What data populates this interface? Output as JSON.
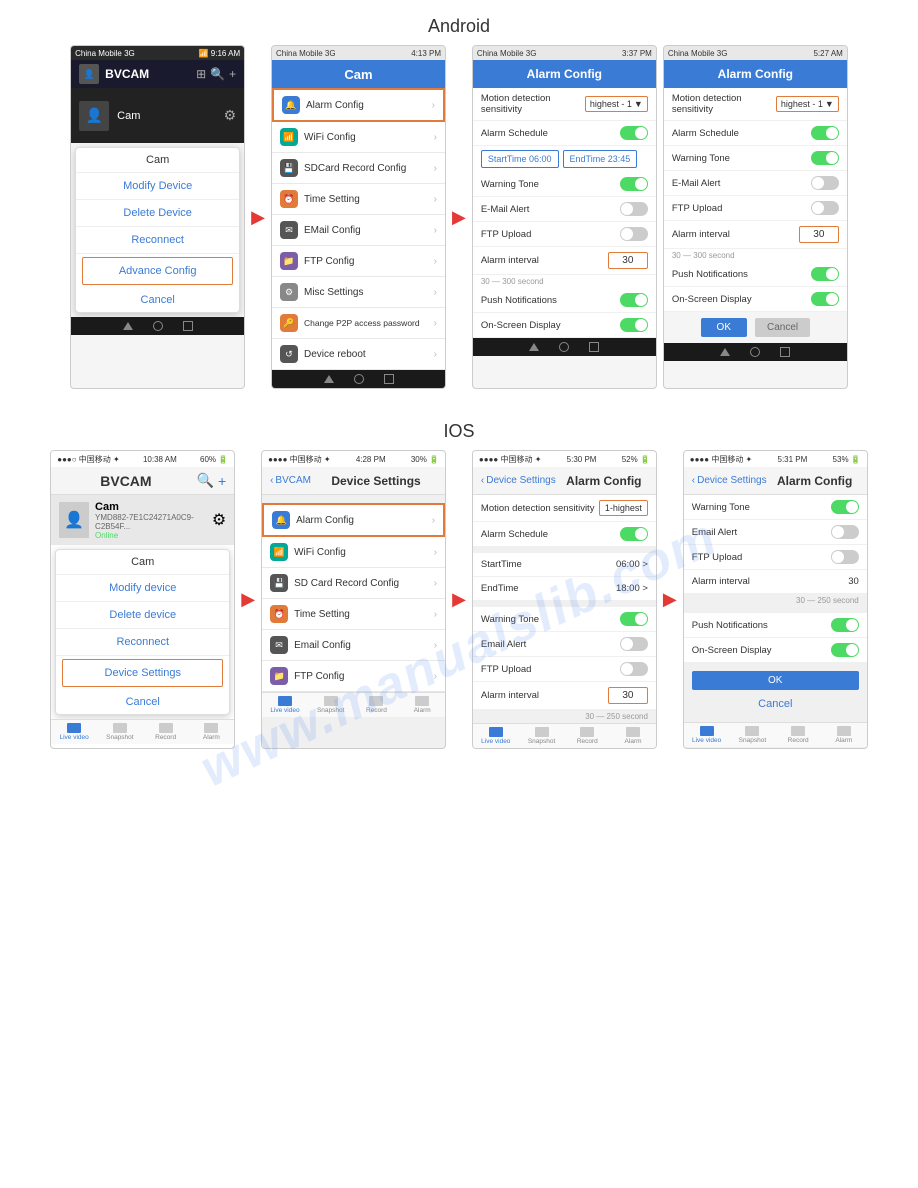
{
  "watermark": {
    "line1": "www.manualslib.com",
    "line2": "www.manualslib.com"
  },
  "android": {
    "label": "Android",
    "phones": [
      {
        "id": "android-1",
        "status_bar": {
          "carrier": "China Mobile 3G",
          "time": "9:16 AM",
          "icons": "signal wifi bat"
        },
        "header": {
          "title": "BVCAM",
          "type": "dark"
        },
        "cam_name": "Cam",
        "menu_items": [
          {
            "label": "Modify Device",
            "type": "normal"
          },
          {
            "label": "Delete Device",
            "type": "normal"
          },
          {
            "label": "Reconnect",
            "type": "normal"
          },
          {
            "label": "Advance Config",
            "type": "highlighted"
          }
        ],
        "cancel": "Cancel",
        "bottom_nav": [
          "back",
          "home",
          "recent"
        ]
      },
      {
        "id": "android-2",
        "status_bar": {
          "carrier": "China Mobile 3G",
          "time": "4:13 PM",
          "icons": "signal wifi bat"
        },
        "header": {
          "title": "Cam",
          "type": "light"
        },
        "list_items": [
          {
            "label": "Alarm Config",
            "icon": "bell",
            "icon_color": "blue",
            "highlighted": true
          },
          {
            "label": "WiFi Config",
            "icon": "wifi",
            "icon_color": "teal"
          },
          {
            "label": "SDCard Record Config",
            "icon": "sd",
            "icon_color": "dark-gray"
          },
          {
            "label": "Time Setting",
            "icon": "clock",
            "icon_color": "orange"
          },
          {
            "label": "EMail Config",
            "icon": "mail",
            "icon_color": "dark-gray"
          },
          {
            "label": "FTP Config",
            "icon": "ftp",
            "icon_color": "purple"
          },
          {
            "label": "Misc Settings",
            "icon": "gear",
            "icon_color": "gear"
          },
          {
            "label": "Change P2P access password",
            "icon": "key",
            "icon_color": "key"
          },
          {
            "label": "Device reboot",
            "icon": "refresh",
            "icon_color": "refresh"
          }
        ],
        "bottom_nav": [
          "back",
          "home",
          "recent"
        ]
      },
      {
        "id": "android-3",
        "status_bar": {
          "carrier": "China Mobile 3G",
          "time": "3:37 PM",
          "icons": "signal wifi bat"
        },
        "header": {
          "title": "Alarm Config",
          "type": "light"
        },
        "rows": [
          {
            "label": "Motion detection sensitivity",
            "value": "highest - 1",
            "type": "dropdown"
          },
          {
            "label": "Alarm Schedule",
            "value": "on",
            "type": "toggle"
          },
          {
            "type": "time_btns",
            "start": "StartTime 06:00",
            "end": "EndTime 23:45"
          },
          {
            "label": "Warning Tone",
            "value": "on",
            "type": "toggle"
          },
          {
            "label": "E-Mail Alert",
            "value": "off",
            "type": "toggle"
          },
          {
            "label": "FTP Upload",
            "value": "off",
            "type": "toggle"
          },
          {
            "label": "Alarm interval",
            "value": "30",
            "type": "input"
          },
          {
            "type": "hint",
            "text": "30 — 300 second"
          },
          {
            "label": "Push Notifications",
            "value": "on",
            "type": "toggle"
          },
          {
            "label": "On-Screen Display",
            "value": "on",
            "type": "toggle"
          }
        ],
        "bottom_nav": [
          "back",
          "home",
          "recent"
        ]
      },
      {
        "id": "android-4",
        "status_bar": {
          "carrier": "China Mobile 3G",
          "time": "5:27 AM",
          "icons": "signal wifi bat"
        },
        "header": {
          "title": "Alarm Config",
          "type": "light"
        },
        "rows": [
          {
            "label": "Motion detection sensitivity",
            "value": "highest - 1",
            "type": "dropdown"
          },
          {
            "label": "Alarm Schedule",
            "value": "on",
            "type": "toggle"
          },
          {
            "label": "Warning Tone",
            "value": "on",
            "type": "toggle"
          },
          {
            "label": "E-Mail Alert",
            "value": "off",
            "type": "toggle"
          },
          {
            "label": "FTP Upload",
            "value": "off",
            "type": "toggle"
          },
          {
            "label": "Alarm interval",
            "value": "30",
            "type": "input_orange"
          },
          {
            "type": "hint",
            "text": "30 — 300 second"
          },
          {
            "label": "Push Notifications",
            "value": "on",
            "type": "toggle"
          },
          {
            "label": "On-Screen Display",
            "value": "on",
            "type": "toggle"
          }
        ],
        "ok": "OK",
        "cancel": "Cancel",
        "bottom_nav": [
          "back",
          "home",
          "recent"
        ]
      }
    ]
  },
  "ios": {
    "label": "IOS",
    "phones": [
      {
        "id": "ios-1",
        "status_bar": {
          "carrier": "中国移动 ✦",
          "time": "10:38 AM",
          "battery": "60%"
        },
        "header": {
          "title": "BVCAM",
          "type": "ios"
        },
        "cam_name": "Cam",
        "cam_id": "YMD882-7E1C24271A0C9-C2B54F...",
        "cam_status": "Online",
        "menu_items": [
          {
            "label": "Modify device",
            "type": "normal"
          },
          {
            "label": "Delete device",
            "type": "normal"
          },
          {
            "label": "Reconnect",
            "type": "normal"
          },
          {
            "label": "Device Settings",
            "type": "highlighted"
          }
        ],
        "cancel": "Cancel",
        "bottom_tabs": [
          "Live video",
          "Snapshot",
          "Record",
          "Alarm"
        ]
      },
      {
        "id": "ios-2",
        "status_bar": {
          "carrier": "中国移动 ✦",
          "time": "4:28 PM",
          "battery": "30%"
        },
        "header_back": "BVCAM",
        "header_title": "Device Settings",
        "list_items": [
          {
            "label": "Alarm Config",
            "icon": "bell",
            "icon_color": "blue",
            "highlighted": true
          },
          {
            "label": "WiFi Config",
            "icon": "wifi",
            "icon_color": "teal"
          },
          {
            "label": "SD Card Record Config",
            "icon": "sd",
            "icon_color": "dark-gray"
          },
          {
            "label": "Time Setting",
            "icon": "clock",
            "icon_color": "orange"
          },
          {
            "label": "Email Config",
            "icon": "mail",
            "icon_color": "dark-gray"
          },
          {
            "label": "FTP Config",
            "icon": "ftp",
            "icon_color": "purple"
          }
        ],
        "bottom_tabs": [
          "Live video",
          "Snapshot",
          "Record",
          "Alarm"
        ]
      },
      {
        "id": "ios-3",
        "status_bar": {
          "carrier": "中国移动 ✦",
          "time": "5:30 PM",
          "battery": "52%"
        },
        "header_back": "Device Settings",
        "header_title": "Alarm Config",
        "rows": [
          {
            "label": "Motion detection sensitivity",
            "value": "1-highest",
            "type": "button_highlight"
          },
          {
            "label": "Alarm Schedule",
            "value": "on",
            "type": "toggle"
          },
          {
            "label": "StartTime",
            "value": "06:00 >",
            "type": "value"
          },
          {
            "label": "EndTime",
            "value": "18:00 >",
            "type": "value"
          },
          {
            "label": "Warning Tone",
            "value": "on",
            "type": "toggle"
          },
          {
            "label": "Email Alert",
            "value": "off",
            "type": "toggle"
          },
          {
            "label": "FTP Upload",
            "value": "off",
            "type": "toggle"
          },
          {
            "label": "Alarm interval",
            "value": "30",
            "type": "input"
          },
          {
            "type": "hint",
            "text": "30 — 250 second"
          }
        ],
        "bottom_tabs": [
          "Live video",
          "Snapshot",
          "Record",
          "Alarm"
        ]
      },
      {
        "id": "ios-4",
        "status_bar": {
          "carrier": "中国移动 ✦",
          "time": "5:31 PM",
          "battery": "53%"
        },
        "header_back": "Device Settings",
        "header_title": "Alarm Config",
        "rows": [
          {
            "label": "Warning Tone",
            "value": "on",
            "type": "toggle"
          },
          {
            "label": "Email Alert",
            "value": "off",
            "type": "toggle"
          },
          {
            "label": "FTP Upload",
            "value": "off",
            "type": "toggle"
          },
          {
            "label": "Alarm interval",
            "value": "30",
            "type": "value_plain"
          },
          {
            "type": "hint",
            "text": "30 — 250 second"
          },
          {
            "label": "Push Notifications",
            "value": "on",
            "type": "toggle"
          },
          {
            "label": "On-Screen Display",
            "value": "on",
            "type": "toggle"
          }
        ],
        "ok": "OK",
        "cancel": "Cancel",
        "bottom_tabs": [
          "Live video",
          "Snapshot",
          "Record",
          "Alarm"
        ]
      }
    ]
  }
}
